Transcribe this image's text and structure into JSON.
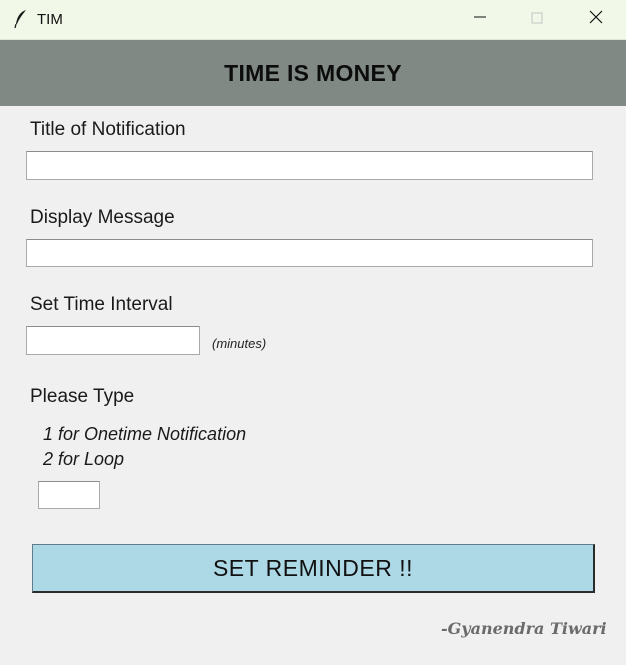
{
  "window": {
    "title": "TIM"
  },
  "banner": {
    "text": "TIME IS MONEY"
  },
  "form": {
    "title_label": "Title of Notification",
    "title_value": "",
    "message_label": "Display Message",
    "message_value": "",
    "interval_label": "Set Time Interval",
    "interval_value": "",
    "interval_unit": "(minutes)",
    "type_label": "Please Type",
    "type_option_1": "1 for Onetime Notification",
    "type_option_2": "2 for Loop",
    "type_value": ""
  },
  "button": {
    "label": "SET REMINDER !!"
  },
  "footer": {
    "signature": "-Gyanendra Tiwari"
  },
  "icons": {
    "app": "feather-icon",
    "minimize": "minimize-icon",
    "maximize": "maximize-icon",
    "close": "close-icon"
  },
  "colors": {
    "banner_bg": "#818985",
    "button_bg": "#add8e6",
    "titlebar_bg": "#f1f8e8"
  }
}
